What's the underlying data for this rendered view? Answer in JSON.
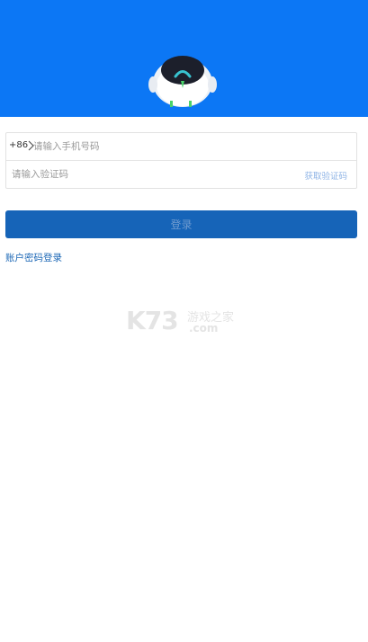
{
  "header": {
    "mascot": "robot-mascot-icon",
    "color": "#0c77f5"
  },
  "login_form": {
    "country_code": "+86",
    "country_chevron": "chevron-right-icon",
    "phone_placeholder": "请输入手机号码",
    "phone_value": "",
    "code_placeholder": "请输入验证码",
    "code_value": "",
    "get_code_label": "获取验证码"
  },
  "actions": {
    "login_label": "登录",
    "login_color": "#1664b8",
    "account_password_login_label": "账户密码登录"
  },
  "watermark": {
    "brand": "K73",
    "cn": "游戏之家",
    "domain": ".com"
  }
}
